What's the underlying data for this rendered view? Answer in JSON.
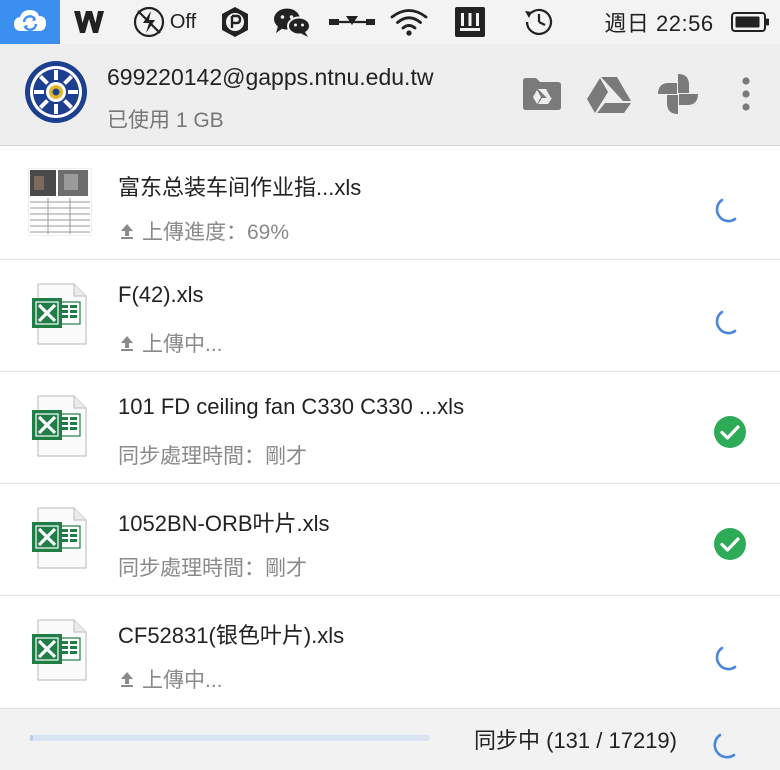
{
  "menubar": {
    "power_label": "Off",
    "clock": "週日 22:56"
  },
  "account": {
    "email": "699220142@gapps.ntnu.edu.tw",
    "usage": "已使用 1 GB"
  },
  "files": [
    {
      "name": "富东总装车间作业指...xls",
      "status": "上傳進度：69%",
      "uploading": true,
      "state": "syncing"
    },
    {
      "name": "F(42).xls",
      "status": "上傳中...",
      "uploading": true,
      "state": "syncing"
    },
    {
      "name": "101 FD ceiling fan C330 C330 ...xls",
      "status": "同步處理時間：剛才",
      "uploading": false,
      "state": "done"
    },
    {
      "name": "1052BN-ORB叶片.xls",
      "status": "同步處理時間：剛才",
      "uploading": false,
      "state": "done"
    },
    {
      "name": "CF52831(银色叶片).xls",
      "status": "上傳中...",
      "uploading": true,
      "state": "syncing"
    }
  ],
  "footer": {
    "sync_status": "同步中 (131 / 17219)",
    "progress": 0.0076
  },
  "colors": {
    "accent_blue": "#3b8ff0",
    "check_green": "#2eab57",
    "spinner_blue": "#4a86e0",
    "excel_green": "#1e7e45"
  }
}
